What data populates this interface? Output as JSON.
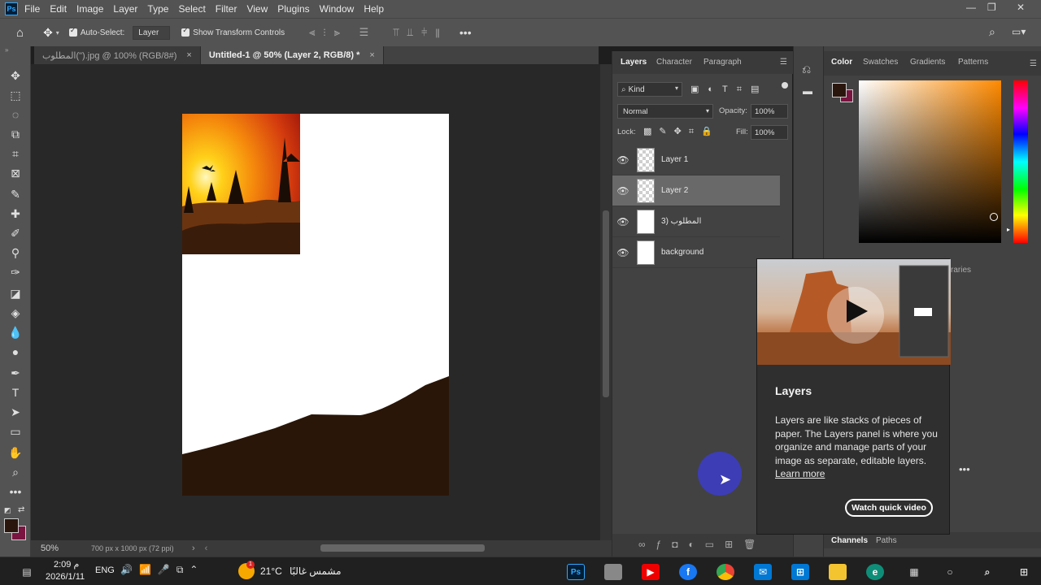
{
  "app": {
    "logo": "Ps",
    "menu": [
      "File",
      "Edit",
      "Image",
      "Layer",
      "Type",
      "Select",
      "Filter",
      "View",
      "Plugins",
      "Window",
      "Help"
    ]
  },
  "options_bar": {
    "auto_select_label": "Auto-Select:",
    "auto_select_value": "Layer",
    "transform_label": "Show Transform Controls"
  },
  "tabs": [
    {
      "label": "المطلوب(\").jpg @ 100% (RGB/8#)",
      "close": "×"
    },
    {
      "label": "Untitled-1 @ 50% (Layer 2, RGB/8) *",
      "close": "×"
    }
  ],
  "status": {
    "zoom": "50%",
    "doc_info": "700 px x 1000 px (72 ppi)"
  },
  "layers_panel": {
    "tabs": [
      "Layers",
      "Character",
      "Paragraph"
    ],
    "filter": "Kind",
    "blend_mode": "Normal",
    "opacity_label": "Opacity:",
    "opacity_value": "100%",
    "lock_label": "Lock:",
    "fill_label": "Fill:",
    "fill_value": "100%",
    "layers": [
      {
        "name": "Layer 1",
        "selected": false
      },
      {
        "name": "Layer 2",
        "selected": true
      },
      {
        "name": "المطلوب (3",
        "selected": false
      },
      {
        "name": "background",
        "selected": false
      }
    ]
  },
  "color_panel": {
    "tabs": [
      "Color",
      "Swatches",
      "Gradients",
      "Patterns"
    ],
    "fg_color": "#2b160e",
    "bg_color": "#7a1440",
    "bottom_tabs": [
      "Channels",
      "Paths"
    ],
    "partial_tab": "raries"
  },
  "tooltip": {
    "title": "Layers",
    "body": "Layers are like stacks of pieces of paper. The Layers panel is where you organize and manage parts of your image as separate, editable layers.",
    "learn_more": "Learn more",
    "button": "Watch quick video"
  },
  "taskbar": {
    "time": "2:09 م",
    "date": "2026/1/11",
    "lang": "ENG",
    "weather_temp": "21°C",
    "weather_text": "مشمس غالبًا",
    "weather_badge": "1"
  }
}
